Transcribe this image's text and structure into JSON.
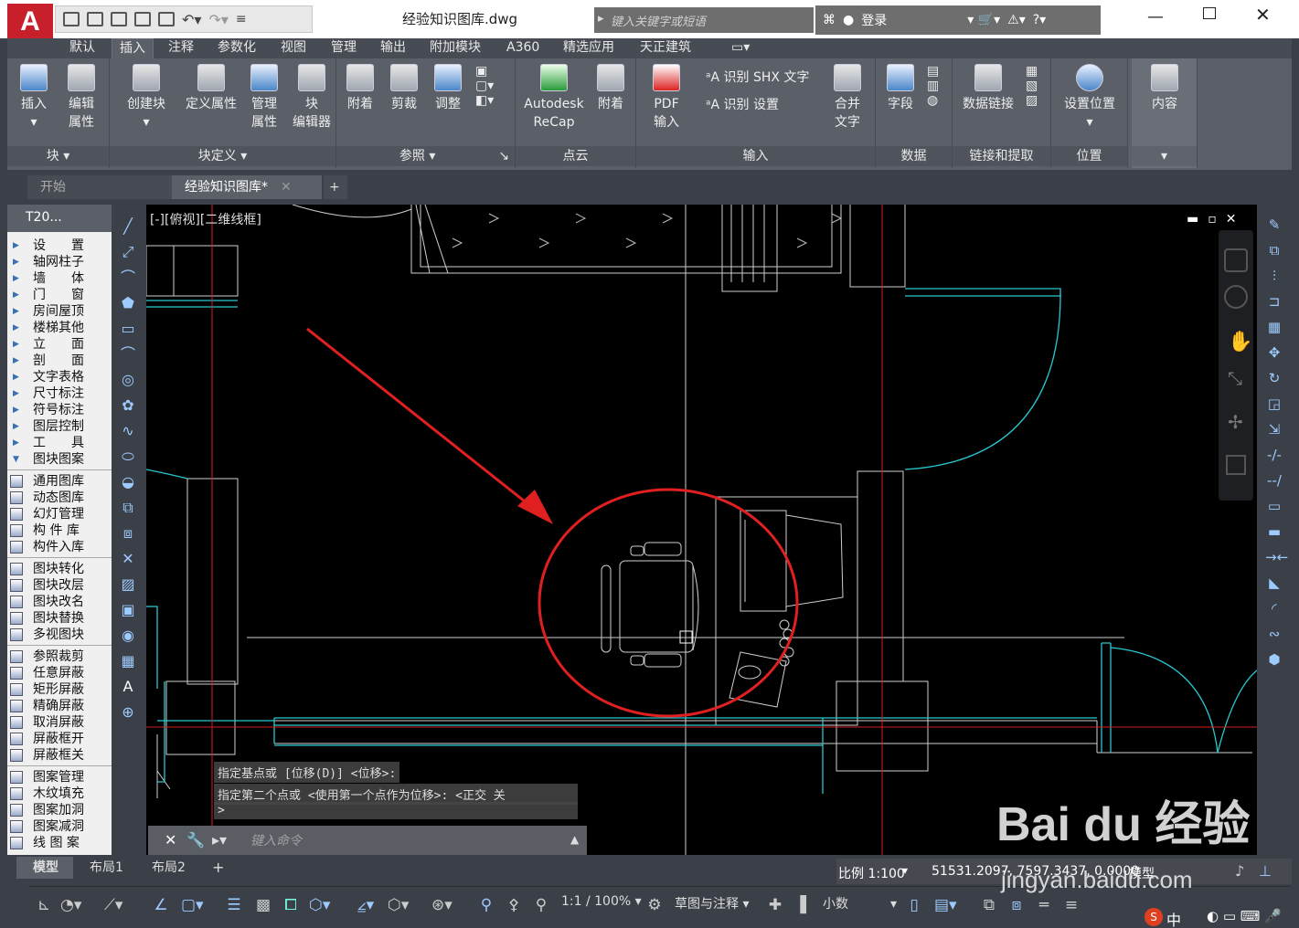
{
  "titlebar": {
    "app_logo": "A",
    "doc_title": "经验知识图库.dwg",
    "search_placeholder": "键入关键字或短语",
    "login": "登录"
  },
  "ribbon_tabs": [
    "默认",
    "插入",
    "注释",
    "参数化",
    "视图",
    "管理",
    "输出",
    "附加模块",
    "A360",
    "精选应用",
    "天正建筑"
  ],
  "active_tab": "插入",
  "ribbon": {
    "block": {
      "insert": "插入",
      "edit_attr": "编辑\n属性",
      "label": "块"
    },
    "block_def": {
      "create": "创建块",
      "define_attr": "定义属性",
      "manage_attr": "管理\n属性",
      "block_editor": "块\n编辑器",
      "label": "块定义"
    },
    "reference": {
      "attach": "附着",
      "clip": "剪裁",
      "adjust": "调整",
      "label": "参照"
    },
    "point_cloud": {
      "recap": "Autodesk\nReCap",
      "attach": "附着",
      "label": "点云"
    },
    "import": {
      "pdf": "PDF\n输入",
      "shx": "识别 SHX 文字",
      "settings": "识别 设置",
      "combine": "合并\n文字",
      "label": "输入"
    },
    "data": {
      "field": "字段",
      "label": "数据"
    },
    "link": {
      "data_link": "数据链接",
      "label": "链接和提取"
    },
    "location": {
      "set": "设置位置",
      "label": "位置"
    },
    "content": {
      "content": "内容"
    }
  },
  "doc_tabs": {
    "start": "开始",
    "current": "经验知识图库*"
  },
  "palette": {
    "title": "T20...",
    "menu": [
      "设　　置",
      "轴网柱子",
      "墙　　体",
      "门　　窗",
      "房间屋顶",
      "楼梯其他",
      "立　　面",
      "剖　　面",
      "文字表格",
      "尺寸标注",
      "符号标注",
      "图层控制",
      "工　　具",
      "图块图案"
    ],
    "group1": [
      "通用图库",
      "动态图库",
      "幻灯管理",
      "构 件 库",
      "构件入库"
    ],
    "group2": [
      "图块转化",
      "图块改层",
      "图块改名",
      "图块替换",
      "多视图块"
    ],
    "group3": [
      "参照裁剪",
      "任意屏蔽",
      "矩形屏蔽",
      "精确屏蔽",
      "取消屏蔽",
      "屏蔽框开",
      "屏蔽框关"
    ],
    "group4": [
      "图案管理",
      "木纹填充",
      "图案加洞",
      "图案减洞",
      "线 图 案"
    ]
  },
  "viewport": {
    "label": "[-][俯视][二维线框]"
  },
  "command": {
    "line1": "指定基点或 [位移(D)] <位移>:",
    "line2": "指定第二个点或 <使用第一个点作为位移>:  <正交 关",
    "line3": ">",
    "input_placeholder": "键入命令"
  },
  "layout_tabs": [
    "模型",
    "布局1",
    "布局2"
  ],
  "status": {
    "scale": "比例 1:100",
    "coords": "51531.2097, 7597.3437, 0.0000",
    "mode": "模型",
    "ratio": "1:1 / 100%",
    "annot": "草图与注释",
    "units": "小数"
  },
  "watermark": {
    "brand": "Bai du 经验",
    "url": "jingyan.baidu.com"
  },
  "tray": {
    "ime": "中"
  }
}
